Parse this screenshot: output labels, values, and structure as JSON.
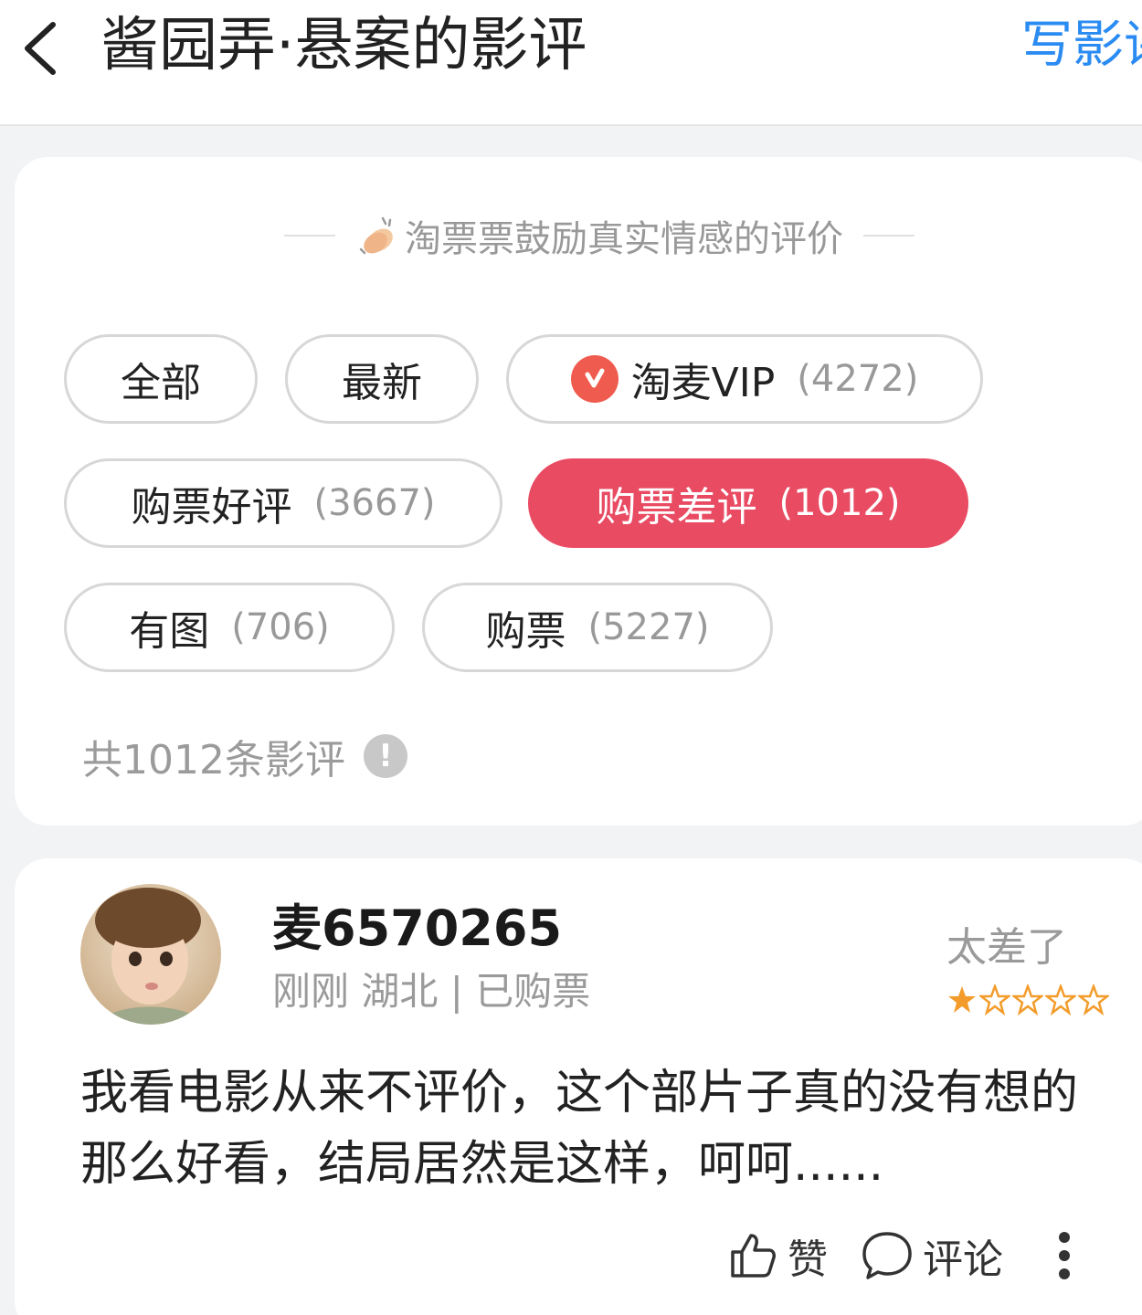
{
  "header": {
    "title": "酱园弄·悬案的影评",
    "write_review_label": "写影评"
  },
  "filters": {
    "encourage_text": "淘票票鼓励真实情感的评价",
    "chips": [
      {
        "label": "全部",
        "count": ""
      },
      {
        "label": "最新",
        "count": ""
      },
      {
        "label": "淘麦VIP",
        "count": "(4272)"
      },
      {
        "label": "购票好评",
        "count": "(3667)"
      },
      {
        "label": "购票差评",
        "count": "(1012)"
      },
      {
        "label": "有图",
        "count": "(706)"
      },
      {
        "label": "购票",
        "count": "(5227)"
      }
    ],
    "active_chip": "购票差评",
    "total_text": "共1012条影评"
  },
  "review": {
    "username": "麦6570265",
    "meta": "刚刚 湖北 | 已购票",
    "rating_text": "太差了",
    "stars_filled": 1,
    "stars_total": 5,
    "text": "我看电影从来不评价，这个部片子真的没有想的那么好看，结局居然是这样，呵呵......",
    "like_label": "赞",
    "comment_label": "评论"
  },
  "colors": {
    "accent": "#e94b63",
    "link": "#2a8bf2",
    "star": "#f39c2b",
    "vip_badge": "#ef5b4e"
  },
  "icons": [
    "back-arrow-icon",
    "clap-icon",
    "vip-badge-icon",
    "info-icon",
    "star-icon",
    "thumbs-up-icon",
    "comment-bubble-icon",
    "more-dots-icon"
  ]
}
